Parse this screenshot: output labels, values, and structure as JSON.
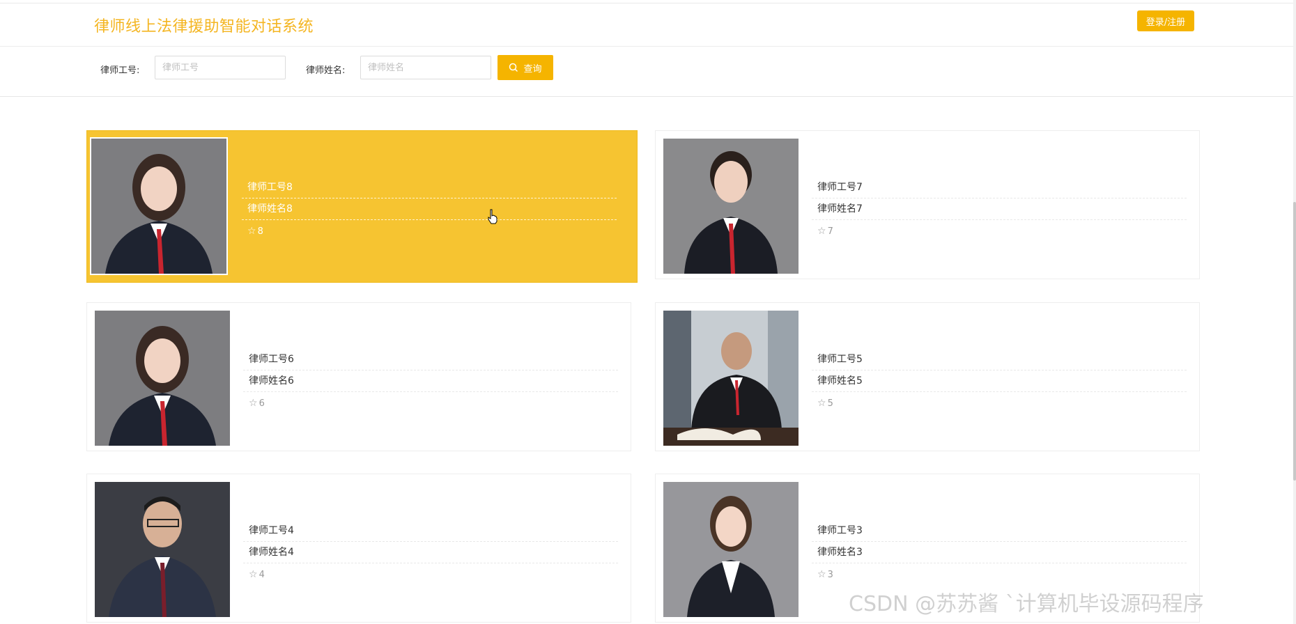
{
  "header": {
    "title": "律师线上法律援助智能对话系统",
    "login_label": "登录/注册"
  },
  "search": {
    "id_label": "律师工号:",
    "id_placeholder": "律师工号",
    "name_label": "律师姓名:",
    "name_placeholder": "律师姓名",
    "button_label": "查询"
  },
  "lawyers": [
    {
      "id": "律师工号8",
      "name": "律师姓名8",
      "stars": "8"
    },
    {
      "id": "律师工号7",
      "name": "律师姓名7",
      "stars": "7"
    },
    {
      "id": "律师工号6",
      "name": "律师姓名6",
      "stars": "6"
    },
    {
      "id": "律师工号5",
      "name": "律师姓名5",
      "stars": "5"
    },
    {
      "id": "律师工号4",
      "name": "律师姓名4",
      "stars": "4"
    },
    {
      "id": "律师工号3",
      "name": "律师姓名3",
      "stars": "3"
    }
  ],
  "watermark": "CSDN @苏苏酱  `计算机毕设源码程序",
  "colors": {
    "accent": "#f5b400",
    "title": "#f4b521",
    "active_card": "#f6c431"
  }
}
